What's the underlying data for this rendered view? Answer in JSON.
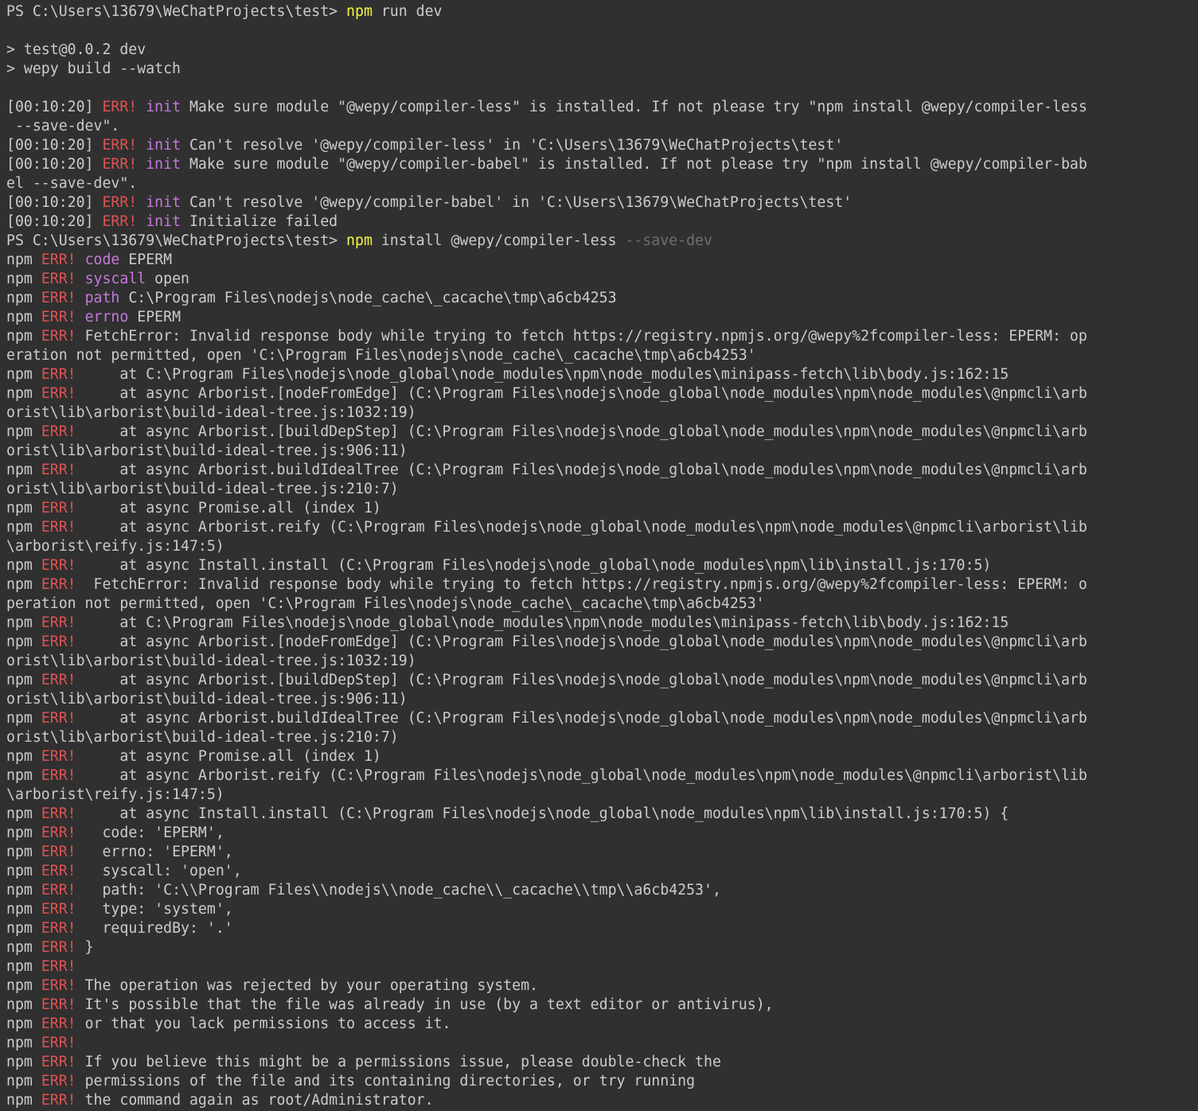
{
  "colors": {
    "background": "#303030",
    "text": "#cccccc",
    "err": "#e05252",
    "keyword": "#c678dd",
    "command": "#f5f543",
    "dim": "#6e6e6e"
  },
  "lines": [
    [
      {
        "t": "PS C:\\Users\\13679\\WeChatProjects\\test> "
      },
      {
        "t": "npm",
        "c": "cmd"
      },
      {
        "t": " run dev"
      }
    ],
    [],
    [
      {
        "t": "> test@0.0.2 dev"
      }
    ],
    [
      {
        "t": "> wepy build --watch"
      }
    ],
    [],
    [
      {
        "t": "[00:10:20] "
      },
      {
        "t": "ERR!",
        "c": "err"
      },
      {
        "t": " "
      },
      {
        "t": "init",
        "c": "kw"
      },
      {
        "t": " Make sure module \"@wepy/compiler-less\" is installed. If not please try \"npm install @wepy/compiler-less"
      }
    ],
    [
      {
        "t": " --save-dev\"."
      }
    ],
    [
      {
        "t": "[00:10:20] "
      },
      {
        "t": "ERR!",
        "c": "err"
      },
      {
        "t": " "
      },
      {
        "t": "init",
        "c": "kw"
      },
      {
        "t": " Can't resolve '@wepy/compiler-less' in 'C:\\Users\\13679\\WeChatProjects\\test'"
      }
    ],
    [
      {
        "t": "[00:10:20] "
      },
      {
        "t": "ERR!",
        "c": "err"
      },
      {
        "t": " "
      },
      {
        "t": "init",
        "c": "kw"
      },
      {
        "t": " Make sure module \"@wepy/compiler-babel\" is installed. If not please try \"npm install @wepy/compiler-bab"
      }
    ],
    [
      {
        "t": "el --save-dev\"."
      }
    ],
    [
      {
        "t": "[00:10:20] "
      },
      {
        "t": "ERR!",
        "c": "err"
      },
      {
        "t": " "
      },
      {
        "t": "init",
        "c": "kw"
      },
      {
        "t": " Can't resolve '@wepy/compiler-babel' in 'C:\\Users\\13679\\WeChatProjects\\test'"
      }
    ],
    [
      {
        "t": "[00:10:20] "
      },
      {
        "t": "ERR!",
        "c": "err"
      },
      {
        "t": " "
      },
      {
        "t": "init",
        "c": "kw"
      },
      {
        "t": " Initialize failed"
      }
    ],
    [
      {
        "t": "PS C:\\Users\\13679\\WeChatProjects\\test> "
      },
      {
        "t": "npm",
        "c": "cmd"
      },
      {
        "t": " install @wepy/compiler-less "
      },
      {
        "t": "--save-dev",
        "c": "dim"
      }
    ],
    [
      {
        "t": "npm "
      },
      {
        "t": "ERR!",
        "c": "err"
      },
      {
        "t": " "
      },
      {
        "t": "code",
        "c": "kw"
      },
      {
        "t": " EPERM"
      }
    ],
    [
      {
        "t": "npm "
      },
      {
        "t": "ERR!",
        "c": "err"
      },
      {
        "t": " "
      },
      {
        "t": "syscall",
        "c": "kw"
      },
      {
        "t": " open"
      }
    ],
    [
      {
        "t": "npm "
      },
      {
        "t": "ERR!",
        "c": "err"
      },
      {
        "t": " "
      },
      {
        "t": "path",
        "c": "kw"
      },
      {
        "t": " C:\\Program Files\\nodejs\\node_cache\\_cacache\\tmp\\a6cb4253"
      }
    ],
    [
      {
        "t": "npm "
      },
      {
        "t": "ERR!",
        "c": "err"
      },
      {
        "t": " "
      },
      {
        "t": "errno",
        "c": "kw"
      },
      {
        "t": " EPERM"
      }
    ],
    [
      {
        "t": "npm "
      },
      {
        "t": "ERR!",
        "c": "err"
      },
      {
        "t": " FetchError: Invalid response body while trying to fetch https://registry.npmjs.org/@wepy%2fcompiler-less: EPERM: op"
      }
    ],
    [
      {
        "t": "eration not permitted, open 'C:\\Program Files\\nodejs\\node_cache\\_cacache\\tmp\\a6cb4253'"
      }
    ],
    [
      {
        "t": "npm "
      },
      {
        "t": "ERR!",
        "c": "err"
      },
      {
        "t": "     at C:\\Program Files\\nodejs\\node_global\\node_modules\\npm\\node_modules\\minipass-fetch\\lib\\body.js:162:15"
      }
    ],
    [
      {
        "t": "npm "
      },
      {
        "t": "ERR!",
        "c": "err"
      },
      {
        "t": "     at async Arborist.[nodeFromEdge] (C:\\Program Files\\nodejs\\node_global\\node_modules\\npm\\node_modules\\@npmcli\\arb"
      }
    ],
    [
      {
        "t": "orist\\lib\\arborist\\build-ideal-tree.js:1032:19)"
      }
    ],
    [
      {
        "t": "npm "
      },
      {
        "t": "ERR!",
        "c": "err"
      },
      {
        "t": "     at async Arborist.[buildDepStep] (C:\\Program Files\\nodejs\\node_global\\node_modules\\npm\\node_modules\\@npmcli\\arb"
      }
    ],
    [
      {
        "t": "orist\\lib\\arborist\\build-ideal-tree.js:906:11)"
      }
    ],
    [
      {
        "t": "npm "
      },
      {
        "t": "ERR!",
        "c": "err"
      },
      {
        "t": "     at async Arborist.buildIdealTree (C:\\Program Files\\nodejs\\node_global\\node_modules\\npm\\node_modules\\@npmcli\\arb"
      }
    ],
    [
      {
        "t": "orist\\lib\\arborist\\build-ideal-tree.js:210:7)"
      }
    ],
    [
      {
        "t": "npm "
      },
      {
        "t": "ERR!",
        "c": "err"
      },
      {
        "t": "     at async Promise.all (index 1)"
      }
    ],
    [
      {
        "t": "npm "
      },
      {
        "t": "ERR!",
        "c": "err"
      },
      {
        "t": "     at async Arborist.reify (C:\\Program Files\\nodejs\\node_global\\node_modules\\npm\\node_modules\\@npmcli\\arborist\\lib"
      }
    ],
    [
      {
        "t": "\\arborist\\reify.js:147:5)"
      }
    ],
    [
      {
        "t": "npm "
      },
      {
        "t": "ERR!",
        "c": "err"
      },
      {
        "t": "     at async Install.install (C:\\Program Files\\nodejs\\node_global\\node_modules\\npm\\lib\\install.js:170:5)"
      }
    ],
    [
      {
        "t": "npm "
      },
      {
        "t": "ERR!",
        "c": "err"
      },
      {
        "t": "  FetchError: Invalid response body while trying to fetch https://registry.npmjs.org/@wepy%2fcompiler-less: EPERM: o"
      }
    ],
    [
      {
        "t": "peration not permitted, open 'C:\\Program Files\\nodejs\\node_cache\\_cacache\\tmp\\a6cb4253'"
      }
    ],
    [
      {
        "t": "npm "
      },
      {
        "t": "ERR!",
        "c": "err"
      },
      {
        "t": "     at C:\\Program Files\\nodejs\\node_global\\node_modules\\npm\\node_modules\\minipass-fetch\\lib\\body.js:162:15"
      }
    ],
    [
      {
        "t": "npm "
      },
      {
        "t": "ERR!",
        "c": "err"
      },
      {
        "t": "     at async Arborist.[nodeFromEdge] (C:\\Program Files\\nodejs\\node_global\\node_modules\\npm\\node_modules\\@npmcli\\arb"
      }
    ],
    [
      {
        "t": "orist\\lib\\arborist\\build-ideal-tree.js:1032:19)"
      }
    ],
    [
      {
        "t": "npm "
      },
      {
        "t": "ERR!",
        "c": "err"
      },
      {
        "t": "     at async Arborist.[buildDepStep] (C:\\Program Files\\nodejs\\node_global\\node_modules\\npm\\node_modules\\@npmcli\\arb"
      }
    ],
    [
      {
        "t": "orist\\lib\\arborist\\build-ideal-tree.js:906:11)"
      }
    ],
    [
      {
        "t": "npm "
      },
      {
        "t": "ERR!",
        "c": "err"
      },
      {
        "t": "     at async Arborist.buildIdealTree (C:\\Program Files\\nodejs\\node_global\\node_modules\\npm\\node_modules\\@npmcli\\arb"
      }
    ],
    [
      {
        "t": "orist\\lib\\arborist\\build-ideal-tree.js:210:7)"
      }
    ],
    [
      {
        "t": "npm "
      },
      {
        "t": "ERR!",
        "c": "err"
      },
      {
        "t": "     at async Promise.all (index 1)"
      }
    ],
    [
      {
        "t": "npm "
      },
      {
        "t": "ERR!",
        "c": "err"
      },
      {
        "t": "     at async Arborist.reify (C:\\Program Files\\nodejs\\node_global\\node_modules\\npm\\node_modules\\@npmcli\\arborist\\lib"
      }
    ],
    [
      {
        "t": "\\arborist\\reify.js:147:5)"
      }
    ],
    [
      {
        "t": "npm "
      },
      {
        "t": "ERR!",
        "c": "err"
      },
      {
        "t": "     at async Install.install (C:\\Program Files\\nodejs\\node_global\\node_modules\\npm\\lib\\install.js:170:5) {"
      }
    ],
    [
      {
        "t": "npm "
      },
      {
        "t": "ERR!",
        "c": "err"
      },
      {
        "t": "   code: 'EPERM',"
      }
    ],
    [
      {
        "t": "npm "
      },
      {
        "t": "ERR!",
        "c": "err"
      },
      {
        "t": "   errno: 'EPERM',"
      }
    ],
    [
      {
        "t": "npm "
      },
      {
        "t": "ERR!",
        "c": "err"
      },
      {
        "t": "   syscall: 'open',"
      }
    ],
    [
      {
        "t": "npm "
      },
      {
        "t": "ERR!",
        "c": "err"
      },
      {
        "t": "   path: 'C:\\\\Program Files\\\\nodejs\\\\node_cache\\\\_cacache\\\\tmp\\\\a6cb4253',"
      }
    ],
    [
      {
        "t": "npm "
      },
      {
        "t": "ERR!",
        "c": "err"
      },
      {
        "t": "   type: 'system',"
      }
    ],
    [
      {
        "t": "npm "
      },
      {
        "t": "ERR!",
        "c": "err"
      },
      {
        "t": "   requiredBy: '.'"
      }
    ],
    [
      {
        "t": "npm "
      },
      {
        "t": "ERR!",
        "c": "err"
      },
      {
        "t": " }"
      }
    ],
    [
      {
        "t": "npm "
      },
      {
        "t": "ERR!",
        "c": "err"
      }
    ],
    [
      {
        "t": "npm "
      },
      {
        "t": "ERR!",
        "c": "err"
      },
      {
        "t": " The operation was rejected by your operating system."
      }
    ],
    [
      {
        "t": "npm "
      },
      {
        "t": "ERR!",
        "c": "err"
      },
      {
        "t": " It's possible that the file was already in use (by a text editor or antivirus),"
      }
    ],
    [
      {
        "t": "npm "
      },
      {
        "t": "ERR!",
        "c": "err"
      },
      {
        "t": " or that you lack permissions to access it."
      }
    ],
    [
      {
        "t": "npm "
      },
      {
        "t": "ERR!",
        "c": "err"
      }
    ],
    [
      {
        "t": "npm "
      },
      {
        "t": "ERR!",
        "c": "err"
      },
      {
        "t": " If you believe this might be a permissions issue, please double-check the"
      }
    ],
    [
      {
        "t": "npm "
      },
      {
        "t": "ERR!",
        "c": "err"
      },
      {
        "t": " permissions of the file and its containing directories, or try running"
      }
    ],
    [
      {
        "t": "npm "
      },
      {
        "t": "ERR!",
        "c": "err"
      },
      {
        "t": " the command again as root/Administrator."
      }
    ]
  ]
}
